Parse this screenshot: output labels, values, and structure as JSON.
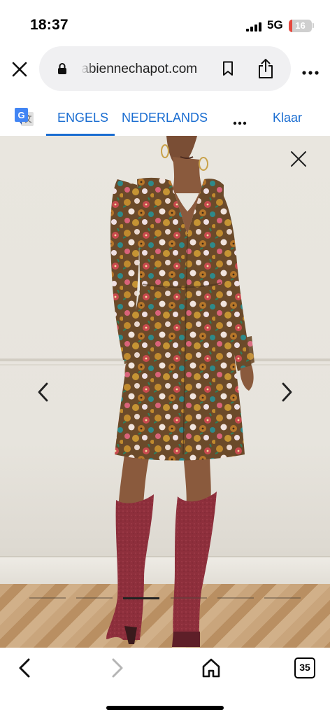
{
  "status_bar": {
    "time": "18:37",
    "network": "5G",
    "battery_level": "16",
    "battery_fraction": 0.16,
    "battery_color": "#e5483e"
  },
  "browser": {
    "url": "fabiennechapot.com",
    "icons": {
      "close": "close-icon",
      "lock": "lock-icon",
      "bookmark": "bookmark-icon",
      "share": "share-icon",
      "menu": "more-icon"
    }
  },
  "translate_bar": {
    "tabs": [
      "ENGELS",
      "NEDERLANDS"
    ],
    "active_tab": "ENGELS",
    "done_label": "Klaar",
    "accent_color": "#1a6dd1"
  },
  "gallery": {
    "slide_count": 6,
    "active_slide": 3
  },
  "toolbar": {
    "tab_count": "35"
  }
}
